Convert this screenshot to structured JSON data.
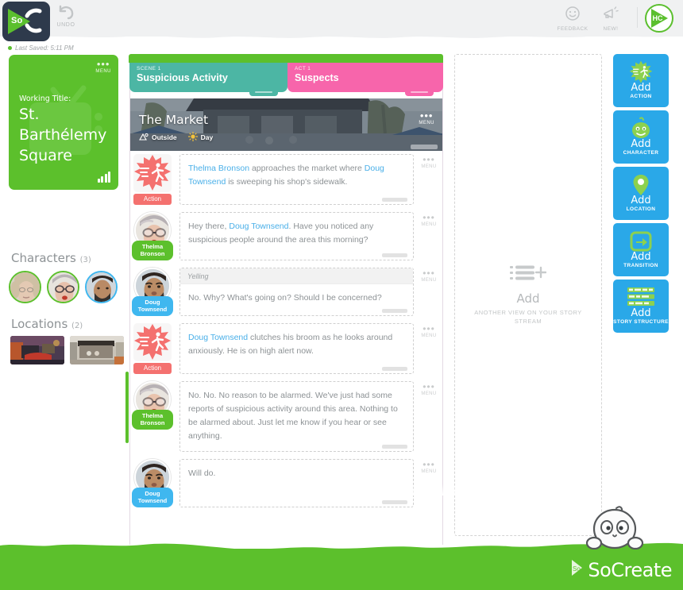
{
  "app": {
    "brand_name": "SoCreate",
    "logo_text": "So",
    "accent_green": "#5cc02c",
    "accent_blue": "#2aa8e8",
    "scene_teal": "#4cb6a4",
    "act_pink": "#f765ab",
    "action_red": "#f4716f"
  },
  "header": {
    "undo_label": "UNDO",
    "feedback_label": "FEEDBACK",
    "news_label": "NEW!",
    "avatar_initials": "HC"
  },
  "save_status": {
    "text": "Last Saved: 5:11 PM"
  },
  "sidebar": {
    "project": {
      "menu_label": "MENU",
      "working_title_label": "Working Title:",
      "title": "St. Barthélemy Square"
    },
    "characters": {
      "heading": "Characters",
      "count": "(3)",
      "items": [
        {
          "name": "character-1",
          "ring": "#5cc02c"
        },
        {
          "name": "character-2",
          "ring": "#5cc02c"
        },
        {
          "name": "character-3",
          "ring": "#3fb7ef"
        }
      ]
    },
    "locations": {
      "heading": "Locations",
      "count": "(2)",
      "items": [
        {
          "name": "location-1"
        },
        {
          "name": "location-2"
        }
      ]
    }
  },
  "stream": {
    "tabs": [
      {
        "kicker": "SCENE 1",
        "name": "Suspicious Activity",
        "type": "scene"
      },
      {
        "kicker": "ACT 1",
        "name": "Suspects",
        "type": "act"
      }
    ],
    "location_banner": {
      "name": "The Market",
      "setting": "Outside",
      "time": "Day",
      "menu_label": "MENU"
    },
    "card_menu_label": "MENU",
    "cards": [
      {
        "type": "action",
        "label": "Action",
        "parenthetical": "",
        "text_parts": [
          {
            "t": "Thelma Bronson",
            "m": true
          },
          {
            "t": " approaches the market where ",
            "m": false
          },
          {
            "t": "Doug Townsend",
            "m": true
          },
          {
            "t": " is sweeping his shop's sidewalk.",
            "m": false
          }
        ]
      },
      {
        "type": "dialogue",
        "speaker": "Thelma Bronson",
        "chip_color": "green",
        "parenthetical": "",
        "text_parts": [
          {
            "t": "Hey there, ",
            "m": false
          },
          {
            "t": "Doug Townsend",
            "m": true
          },
          {
            "t": ". Have you noticed any suspicious people around the area this morning?",
            "m": false
          }
        ]
      },
      {
        "type": "dialogue",
        "speaker": "Doug Townsend",
        "chip_color": "blue",
        "parenthetical": "Yelling",
        "text_parts": [
          {
            "t": "No. Why? What's going on? Should I be concerned?",
            "m": false
          }
        ]
      },
      {
        "type": "action",
        "label": "Action",
        "selected": true,
        "parenthetical": "",
        "text_parts": [
          {
            "t": "Doug Townsend",
            "m": true
          },
          {
            "t": " clutches his broom as he looks around anxiously. He is on high alert now.",
            "m": false
          }
        ]
      },
      {
        "type": "dialogue",
        "speaker": "Thelma Bronson",
        "chip_color": "green",
        "parenthetical": "",
        "text_parts": [
          {
            "t": "No. No. No reason to be alarmed. We've just had some reports of suspicious activity around this area. Nothing to be alarmed about. Just let me know if you hear or see anything.",
            "m": false
          }
        ]
      },
      {
        "type": "dialogue",
        "speaker": "Doug Townsend",
        "chip_color": "blue",
        "parenthetical": "",
        "text_parts": [
          {
            "t": "Will do.",
            "m": false
          }
        ]
      }
    ]
  },
  "empty_panel": {
    "title": "Add",
    "subtitle": "ANOTHER VIEW ON YOUR STORY STREAM"
  },
  "rail": {
    "buttons": [
      {
        "add": "Add",
        "kind": "ACTION",
        "icon": "action-starburst-icon"
      },
      {
        "add": "Add",
        "kind": "CHARACTER",
        "icon": "character-face-icon"
      },
      {
        "add": "Add",
        "kind": "LOCATION",
        "icon": "location-pin-icon"
      },
      {
        "add": "Add",
        "kind": "TRANSITION",
        "icon": "transition-arrow-icon"
      },
      {
        "add": "Add",
        "kind": "STORY STRUCTURE",
        "icon": "story-structure-icon"
      }
    ]
  }
}
